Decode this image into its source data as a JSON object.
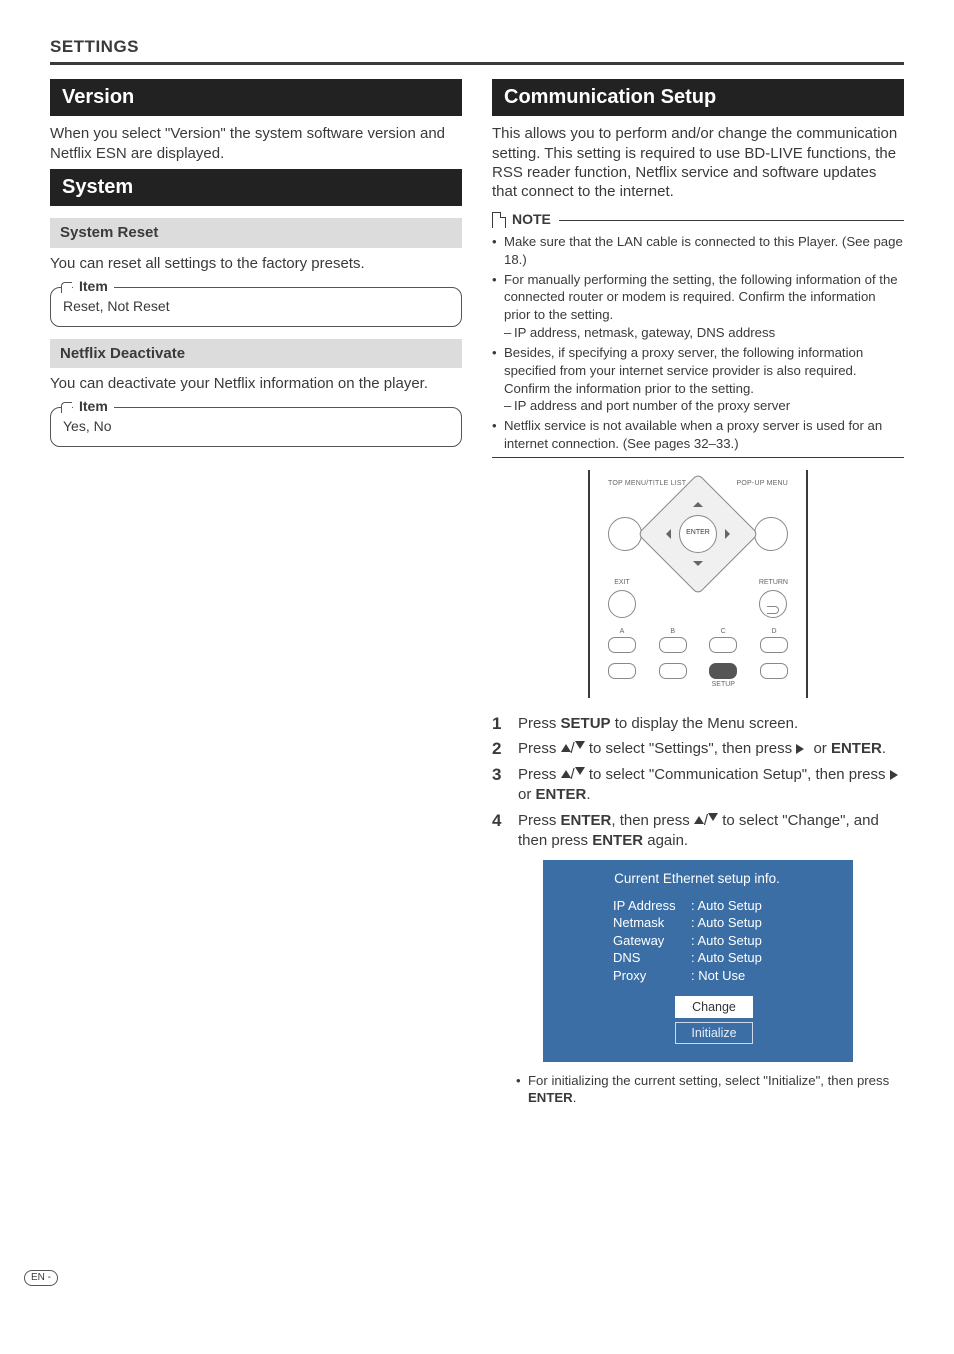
{
  "page": {
    "header": "SETTINGS",
    "footer_lang": "EN"
  },
  "left": {
    "version": {
      "title": "Version",
      "desc": "When you select \"Version\" the system software version and Netflix ESN are displayed."
    },
    "system": {
      "title": "System",
      "system_reset": {
        "title": "System Reset",
        "desc": "You can reset all settings to the factory presets.",
        "item_label": "Item",
        "item_value": "Reset, Not Reset"
      },
      "netflix_deactivate": {
        "title": "Netflix Deactivate",
        "desc": "You can deactivate your Netflix information on the player.",
        "item_label": "Item",
        "item_value": "Yes, No"
      }
    }
  },
  "right": {
    "comm_setup": {
      "title": "Communication Setup",
      "desc": "This allows you to perform and/or change the communication setting. This setting is required to use BD-LIVE functions, the RSS reader function, Netflix service and software updates that connect to the internet."
    },
    "note": {
      "label": "NOTE",
      "bullets": [
        "Make sure that the LAN cable is connected to this Player. (See page 18.)",
        "For manually performing the setting, the following information of the connected router or modem is required. Confirm the information prior to the setting.",
        "Besides, if specifying a proxy server, the following information specified from your internet service provider is also required. Confirm the information prior to the setting.",
        "Netflix service is not available when a proxy server is used for an internet connection. (See pages 32–33.)"
      ],
      "sub1": "IP address, netmask, gateway, DNS address",
      "sub2": "IP address and port number of the proxy server"
    },
    "remote": {
      "top_left": "TOP MENU/TITLE LIST",
      "top_right": "POP-UP MENU",
      "enter": "ENTER",
      "exit": "EXIT",
      "return": "RETURN",
      "abcd": [
        "A",
        "B",
        "C",
        "D"
      ],
      "setup": "SETUP"
    },
    "steps": {
      "s1_a": "Press ",
      "s1_b": " to display the Menu screen.",
      "s1_setup": "SETUP",
      "s2_a": "Press ",
      "s2_b": " to select \"Settings\", then press ",
      "s2_c": " or ",
      "s2_enter": "ENTER",
      "s2_d": ".",
      "s3_a": "Press ",
      "s3_b": " to select \"Communication Setup\", then press ",
      "s3_c": " or ",
      "s3_enter": "ENTER",
      "s3_d": ".",
      "s4_a": "Press ",
      "s4_e1": "ENTER",
      "s4_b": ", then press ",
      "s4_c": " to select \"Change\", and then press ",
      "s4_e2": "ENTER",
      "s4_d": " again."
    },
    "ethernet": {
      "title": "Current Ethernet setup info.",
      "rows": [
        {
          "k": "IP Address",
          "v": ": Auto Setup"
        },
        {
          "k": "Netmask",
          "v": ": Auto Setup"
        },
        {
          "k": "Gateway",
          "v": ": Auto Setup"
        },
        {
          "k": "DNS",
          "v": ": Auto Setup"
        },
        {
          "k": "Proxy",
          "v": ": Not Use"
        }
      ],
      "change": "Change",
      "initialize": "Initialize"
    },
    "postnote_a": "For initializing the current setting, select \"Initialize\", then press ",
    "postnote_enter": "ENTER",
    "postnote_b": "."
  }
}
